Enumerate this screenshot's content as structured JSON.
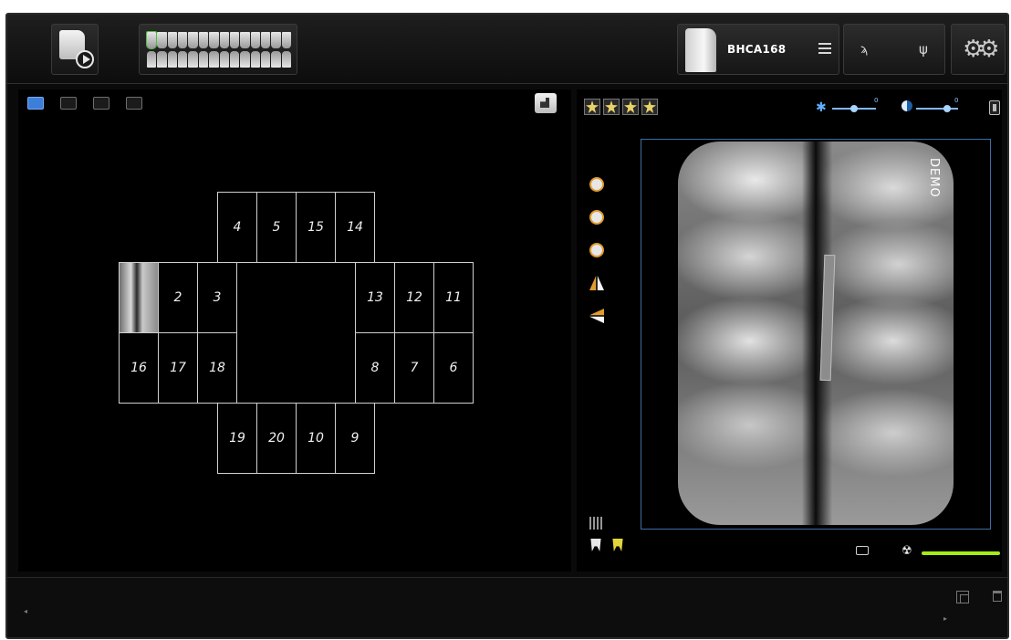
{
  "topbar": {
    "app_icon": "acquire-app-icon",
    "teeth_chart_icon": "full-mouth-teeth-chart-icon",
    "sensor": {
      "name": "BHCA168",
      "icon": "sensor-icon",
      "menu_icon": "menu-icon"
    },
    "status": {
      "wifi_icon": "wifi-icon",
      "usb_icon": "usb-icon"
    },
    "settings_icon": "gear-icon"
  },
  "left_panel": {
    "toolbar": [
      "layout-fmx-icon",
      "layout-single-icon",
      "layout-camera-icon",
      "layout-double-camera-icon"
    ],
    "active_toolbar_index": 0,
    "edit_icon": "edit-template-icon",
    "template_cells": {
      "top_row": [
        "4",
        "5",
        "15",
        "14"
      ],
      "left_upper": [
        "",
        "2",
        "3"
      ],
      "right_upper": [
        "13",
        "12",
        "11"
      ],
      "left_lower": [
        "16",
        "17",
        "18"
      ],
      "right_lower": [
        "8",
        "7",
        "6"
      ],
      "bottom_row": [
        "19",
        "20",
        "10",
        "9"
      ]
    }
  },
  "right_panel": {
    "ratings": 4,
    "brightness_icon": "brightness-icon",
    "contrast_icon": "contrast-icon",
    "brightness_value": "0",
    "contrast_value": "0",
    "tools": [
      "rotate-cw-icon",
      "rotate-180-icon",
      "rotate-ccw-icon",
      "flip-vertical-icon",
      "flip-horizontal-icon"
    ],
    "image_label": "DEMO",
    "bottom_tools": [
      "grid-icon",
      "tooth-icon",
      "tooth-yellow-icon"
    ],
    "camera_icon": "camera-icon",
    "radiation_icon": "radiation-icon",
    "exposure_level": 1.0,
    "accent_color": "#a6ea16"
  },
  "bottombar": {
    "copy_icon": "copy-icon",
    "trash_icon": "trash-icon"
  }
}
